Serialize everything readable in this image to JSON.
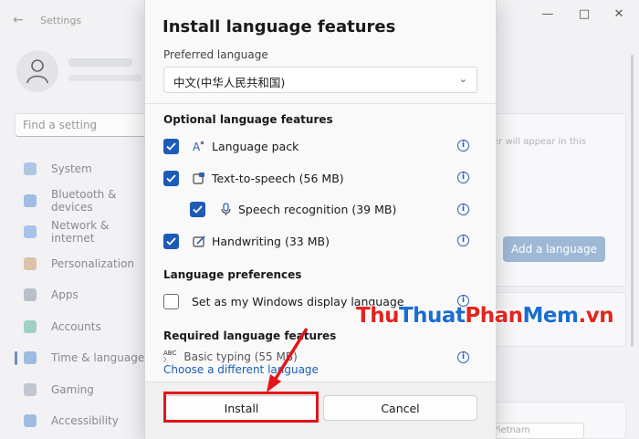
{
  "background": {
    "app_title": "Settings",
    "search_placeholder": "Find a setting",
    "nav_items": [
      {
        "label": "System",
        "color": "#7aa3d6"
      },
      {
        "label": "Bluetooth & devices",
        "color": "#5d8fd4"
      },
      {
        "label": "Network & internet",
        "color": "#6b9be0"
      },
      {
        "label": "Personalization",
        "color": "#c99a6b"
      },
      {
        "label": "Apps",
        "color": "#8a93a8"
      },
      {
        "label": "Accounts",
        "color": "#5fb59a"
      },
      {
        "label": "Time & language",
        "color": "#5a8fd0"
      },
      {
        "label": "Gaming",
        "color": "#9aa2b0"
      },
      {
        "label": "Accessibility",
        "color": "#5d8fd4"
      }
    ],
    "active_nav": "Time & language",
    "heading_fragment": "n",
    "card_text": "er will appear in this",
    "add_language_button": "Add a language",
    "region_value": "Vietnam"
  },
  "dialog": {
    "title": "Install language features",
    "preferred_language_label": "Preferred language",
    "preferred_language_value": "中文(中华人民共和国)",
    "optional_section": "Optional language features",
    "optional_features": [
      {
        "label": "Language pack",
        "checked": true,
        "icon": "language-pack-icon"
      },
      {
        "label": "Text-to-speech (56 MB)",
        "checked": true,
        "icon": "text-to-speech-icon"
      },
      {
        "label": "Speech recognition (39 MB)",
        "checked": true,
        "icon": "microphone-icon"
      },
      {
        "label": "Handwriting (33 MB)",
        "checked": true,
        "icon": "handwriting-icon"
      }
    ],
    "preferences_section": "Language preferences",
    "display_language_option": {
      "label": "Set as my Windows display language",
      "checked": false
    },
    "required_section": "Required language features",
    "required_feature": "Basic typing (55 MB)",
    "choose_link": "Choose a different language",
    "install_button": "Install",
    "cancel_button": "Cancel"
  },
  "watermark": {
    "part1": "Thu",
    "part2": "Thuat",
    "part3": "Phan",
    "part4": "Mem",
    "part5": ".vn"
  },
  "accent_color": "#1e5bb8",
  "highlight_color": "#e3151a"
}
